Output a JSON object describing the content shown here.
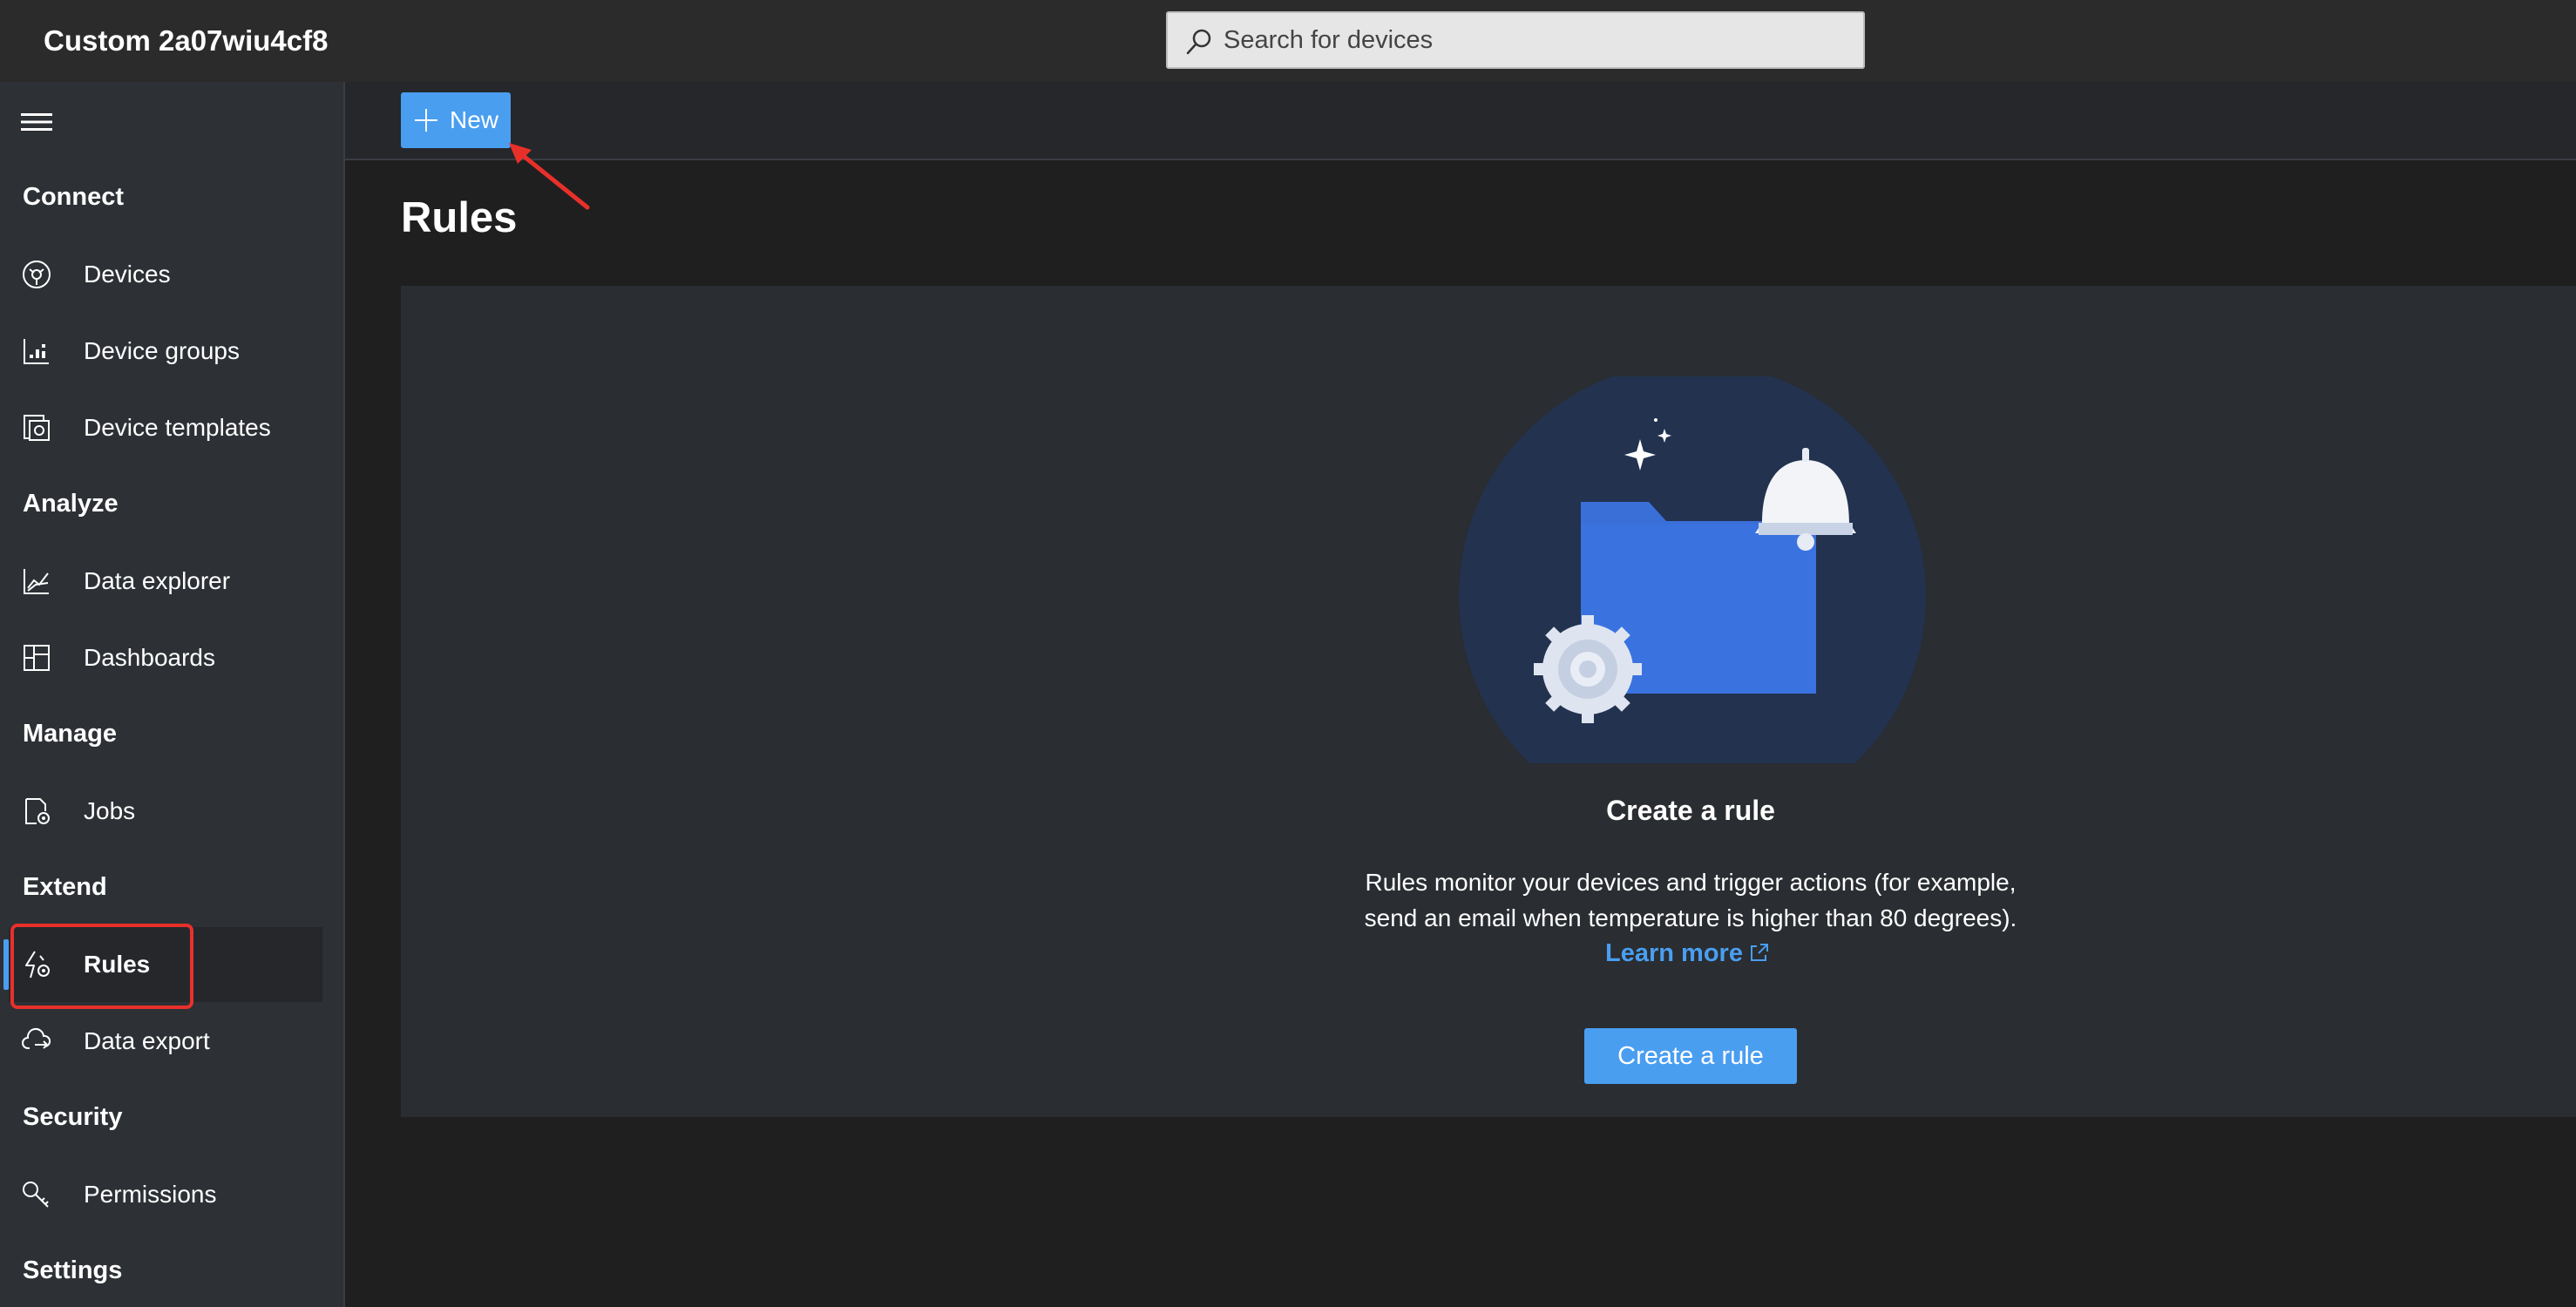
{
  "app": {
    "title": "Custom 2a07wiu4cf8"
  },
  "search": {
    "placeholder": "Search for devices"
  },
  "sidebar": {
    "sections": [
      {
        "label": "Connect",
        "items": [
          {
            "label": "Devices",
            "icon": "devices-icon"
          },
          {
            "label": "Device groups",
            "icon": "device-groups-icon"
          },
          {
            "label": "Device templates",
            "icon": "device-templates-icon"
          }
        ]
      },
      {
        "label": "Analyze",
        "items": [
          {
            "label": "Data explorer",
            "icon": "chart-line-icon"
          },
          {
            "label": "Dashboards",
            "icon": "dashboard-icon"
          }
        ]
      },
      {
        "label": "Manage",
        "items": [
          {
            "label": "Jobs",
            "icon": "jobs-icon"
          }
        ]
      },
      {
        "label": "Extend",
        "items": [
          {
            "label": "Rules",
            "icon": "rules-icon",
            "active": true
          },
          {
            "label": "Data export",
            "icon": "cloud-export-icon"
          }
        ]
      },
      {
        "label": "Security",
        "items": [
          {
            "label": "Permissions",
            "icon": "key-icon"
          }
        ]
      },
      {
        "label": "Settings",
        "items": []
      }
    ]
  },
  "toolbar": {
    "new_label": "New"
  },
  "main": {
    "title": "Rules",
    "empty_state": {
      "title": "Create a rule",
      "description_line1": "Rules monitor your devices and trigger actions (for example,",
      "description_line2": "send an email when temperature is higher than 80 degrees).",
      "learn_more": "Learn more",
      "button": "Create a rule"
    }
  },
  "colors": {
    "accent": "#4a9ef0",
    "annotation": "#e8302b",
    "sidebar_bg": "#2d3035",
    "topbar_bg": "#2b2b2b",
    "main_bg": "#1f1f1f",
    "card_bg": "#2a2d31"
  }
}
